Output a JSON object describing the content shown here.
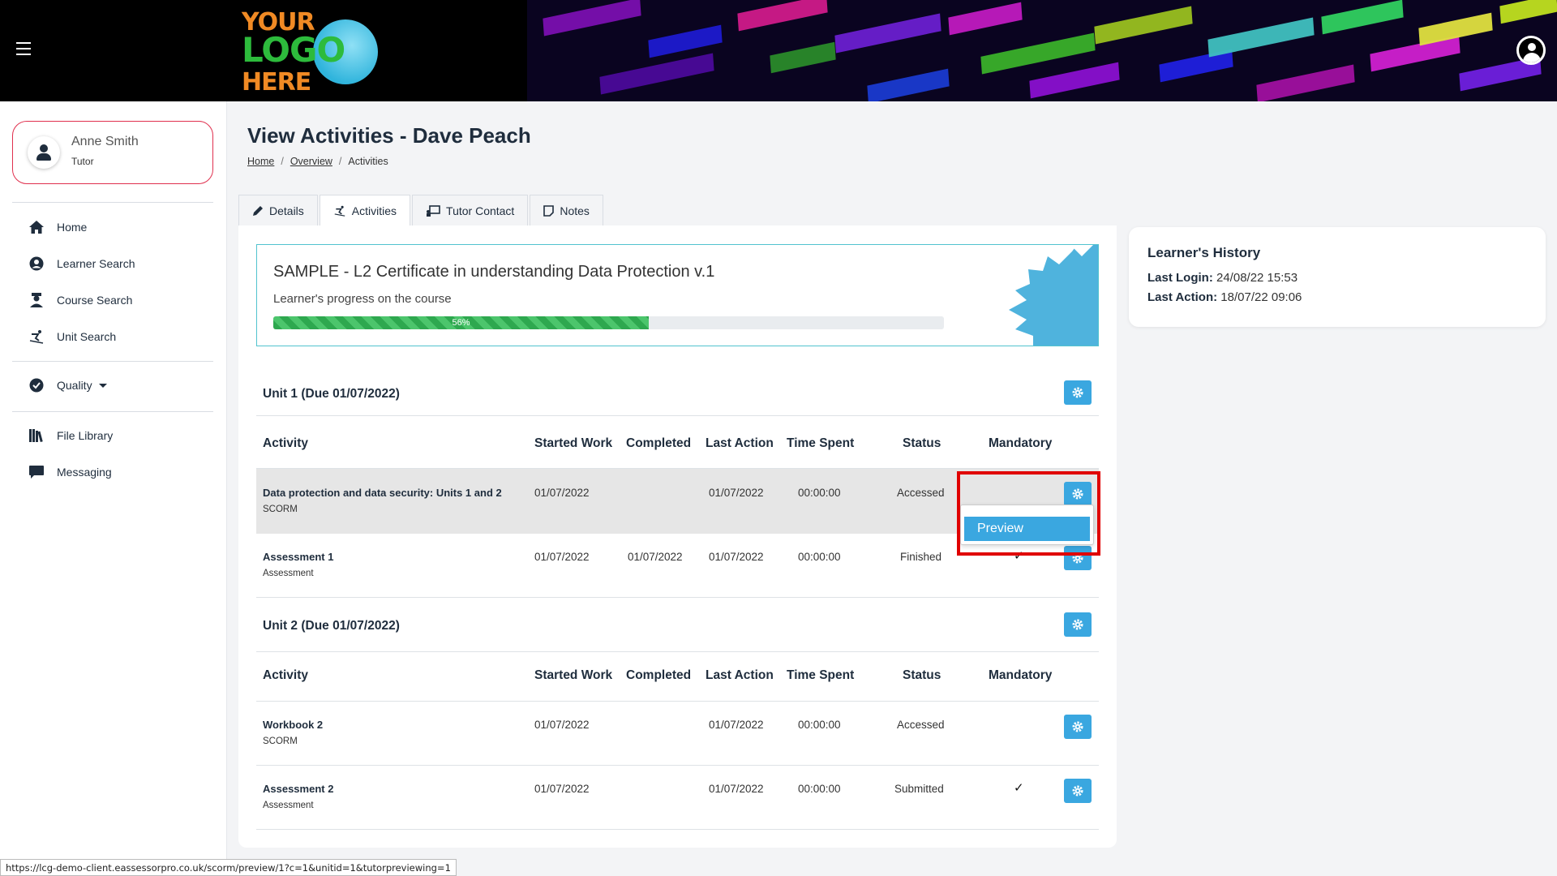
{
  "header": {
    "logo_line1": "YOUR",
    "logo_line2": "LOGO",
    "logo_line3": "HERE"
  },
  "user": {
    "name": "Anne Smith",
    "role": "Tutor"
  },
  "sidebar": {
    "items": [
      {
        "label": "Home",
        "icon": "home-icon"
      },
      {
        "label": "Learner Search",
        "icon": "user-circle-icon"
      },
      {
        "label": "Course Search",
        "icon": "graduate-icon"
      },
      {
        "label": "Unit Search",
        "icon": "skier-icon"
      },
      {
        "label": "Quality",
        "icon": "check-circle-icon"
      },
      {
        "label": "File Library",
        "icon": "books-icon"
      },
      {
        "label": "Messaging",
        "icon": "chat-icon"
      }
    ]
  },
  "page": {
    "title": "View Activities - Dave Peach",
    "breadcrumb": {
      "home": "Home",
      "overview": "Overview",
      "current": "Activities",
      "sep": "/"
    }
  },
  "tabs": [
    {
      "label": "Details",
      "icon": "pencil-icon"
    },
    {
      "label": "Activities",
      "icon": "skier-icon"
    },
    {
      "label": "Tutor Contact",
      "icon": "chalkboard-icon"
    },
    {
      "label": "Notes",
      "icon": "note-icon"
    }
  ],
  "course": {
    "title": "SAMPLE - L2 Certificate in understanding Data Protection v.1",
    "progress_label": "Learner's progress on the course",
    "progress_text": "56%",
    "progress_fraction": 0.56
  },
  "table_headers": [
    "Activity",
    "Started Work",
    "Completed",
    "Last Action",
    "Time Spent",
    "Status",
    "Mandatory"
  ],
  "units": [
    {
      "title": "Unit 1 (Due 01/07/2022)",
      "rows": [
        {
          "name": "Data protection and data security: Units 1 and 2",
          "type": "SCORM",
          "started": "01/07/2022",
          "completed": "",
          "last_action": "01/07/2022",
          "time_spent": "00:00:00",
          "status": "Accessed",
          "mandatory": ""
        },
        {
          "name": "Assessment 1",
          "type": "Assessment",
          "started": "01/07/2022",
          "completed": "01/07/2022",
          "last_action": "01/07/2022",
          "time_spent": "00:00:00",
          "status": "Finished",
          "mandatory": "✓"
        }
      ]
    },
    {
      "title": "Unit 2 (Due 01/07/2022)",
      "rows": [
        {
          "name": "Workbook 2",
          "type": "SCORM",
          "started": "01/07/2022",
          "completed": "",
          "last_action": "01/07/2022",
          "time_spent": "00:00:00",
          "status": "Accessed",
          "mandatory": ""
        },
        {
          "name": "Assessment 2",
          "type": "Assessment",
          "started": "01/07/2022",
          "completed": "",
          "last_action": "01/07/2022",
          "time_spent": "00:00:00",
          "status": "Submitted",
          "mandatory": "✓"
        }
      ]
    }
  ],
  "dropdown": {
    "item": "Preview"
  },
  "history": {
    "title": "Learner's History",
    "last_login_label": "Last Login:",
    "last_login": "24/08/22 15:53",
    "last_action_label": "Last Action:",
    "last_action": "18/07/22 09:06"
  },
  "status_url": "https://lcg-demo-client.eassessorpro.co.uk/scorm/preview/1?c=1&unitid=1&tutorpreviewing=1",
  "colors": {
    "accent": "#3aa7e0",
    "highlight": "#e00000",
    "user_border": "#e0304e",
    "progress": "#2ea84f"
  }
}
